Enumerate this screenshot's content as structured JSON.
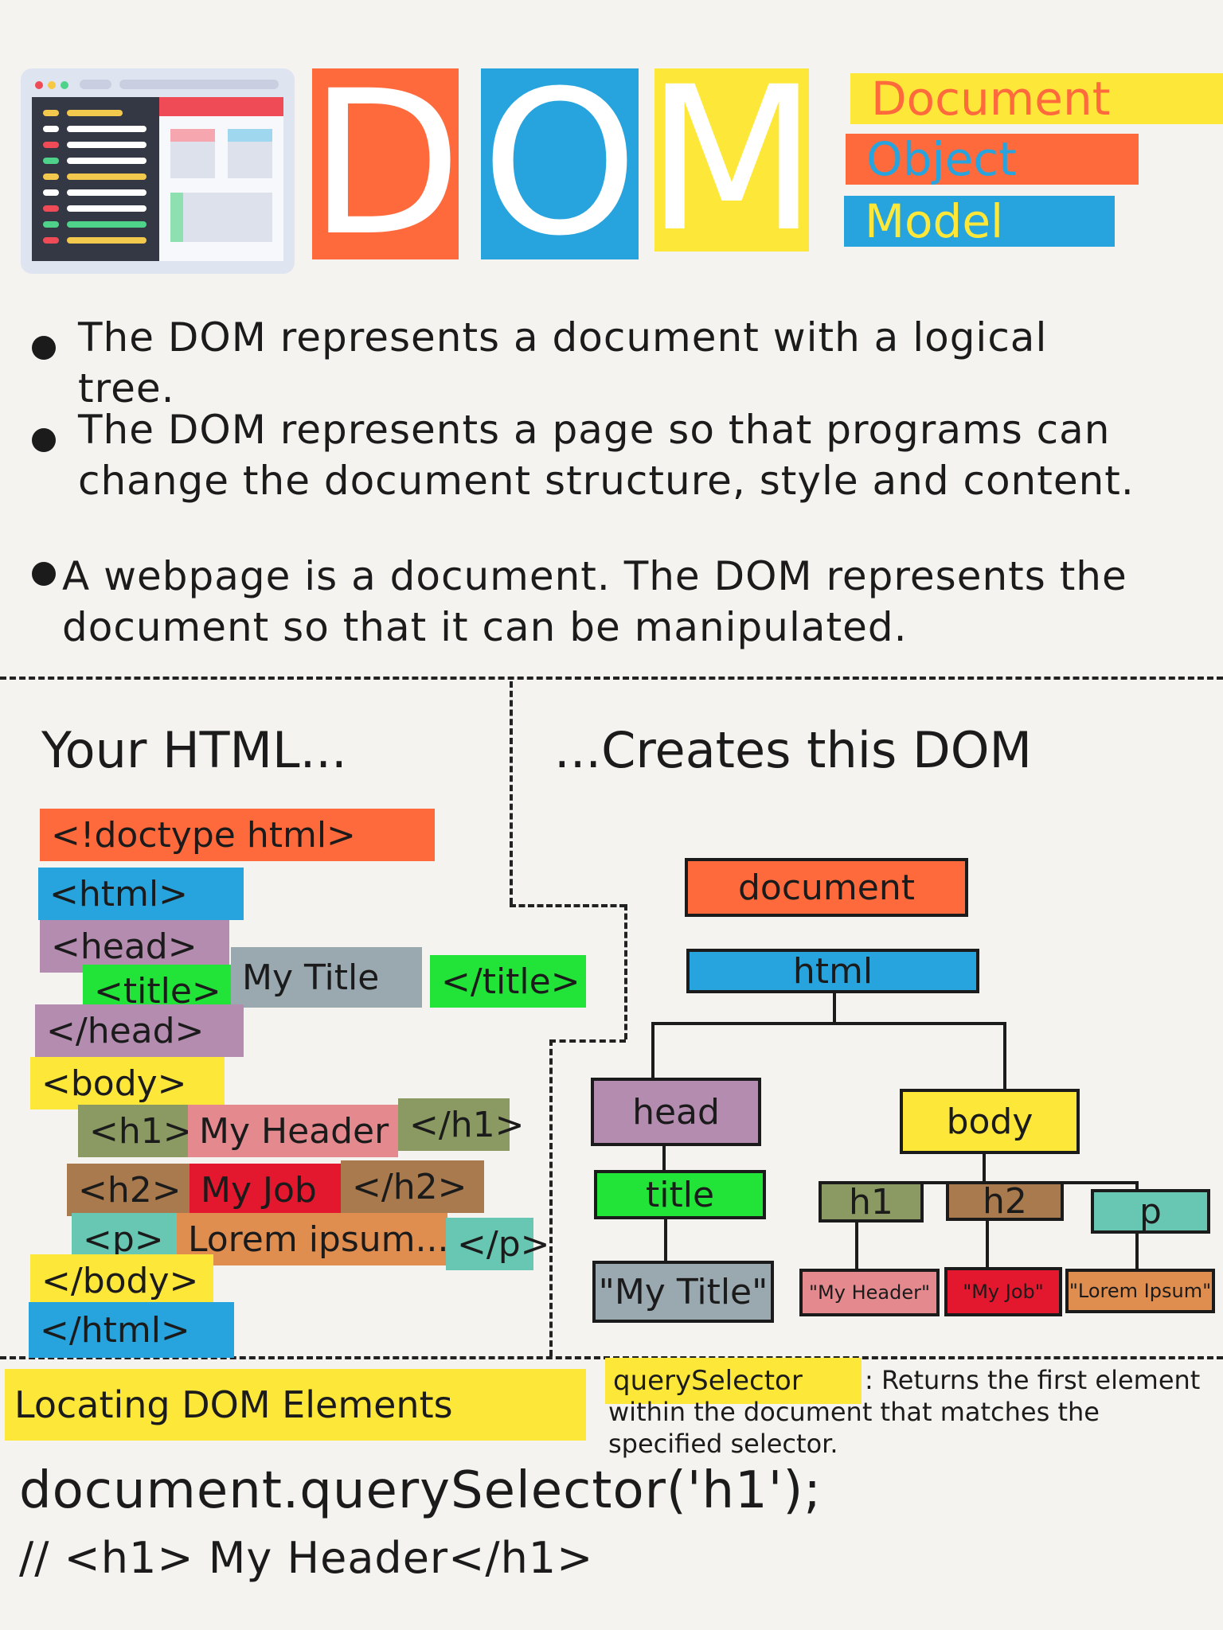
{
  "header": {
    "letters": [
      "D",
      "O",
      "M"
    ],
    "title_words": [
      "Document",
      "Object",
      "Model"
    ]
  },
  "bullets": [
    "The DOM represents a document with a logical tree.",
    "The DOM represents a page so that programs can change the document structure, style and content.",
    "A webpage is a document. The DOM represents the document so that it can be manipulated."
  ],
  "html_section": {
    "heading": "Your HTML...",
    "lines": {
      "doctype": "<!doctype html>",
      "html_open": "<html>",
      "head_open": "<head>",
      "title_open": "<title>",
      "title_text": "My Title",
      "title_close": "</title>",
      "head_close": "</head>",
      "body_open": "<body>",
      "h1_open": "<h1>",
      "h1_text": "My Header",
      "h1_close": "</h1>",
      "h2_open": "<h2>",
      "h2_text": "My Job",
      "h2_close": "</h2>",
      "p_open": "<p>",
      "p_text": "Lorem ipsum...",
      "p_close": "</p>",
      "body_close": "</body>",
      "html_close": "</html>"
    }
  },
  "dom_section": {
    "heading": "...Creates this DOM",
    "nodes": {
      "document": "document",
      "html": "html",
      "head": "head",
      "body": "body",
      "title": "title",
      "h1": "h1",
      "h2": "h2",
      "p": "p",
      "title_text": "\"My Title\"",
      "h1_text": "\"My Header\"",
      "h2_text": "\"My Job\"",
      "p_text": "\"Lorem Ipsum\""
    }
  },
  "locating": {
    "heading": "Locating DOM Elements",
    "method": "querySelector",
    "description": ": Returns the first element within the document that matches the specified selector.",
    "code": "document.querySelector('h1');",
    "comment": "// <h1> My Header</h1>"
  },
  "colors": {
    "orange": "#ff6a3d",
    "blue": "#27a4dd",
    "yellow": "#fde83a",
    "purple": "#b48cb0",
    "green": "#22e337",
    "gray": "#9aa8b0",
    "olive": "#8a9a62",
    "pink": "#e48a8f",
    "brown": "#a87a4d",
    "red": "#e3172d",
    "tan": "#e08e50",
    "teal": "#68c7b3"
  }
}
